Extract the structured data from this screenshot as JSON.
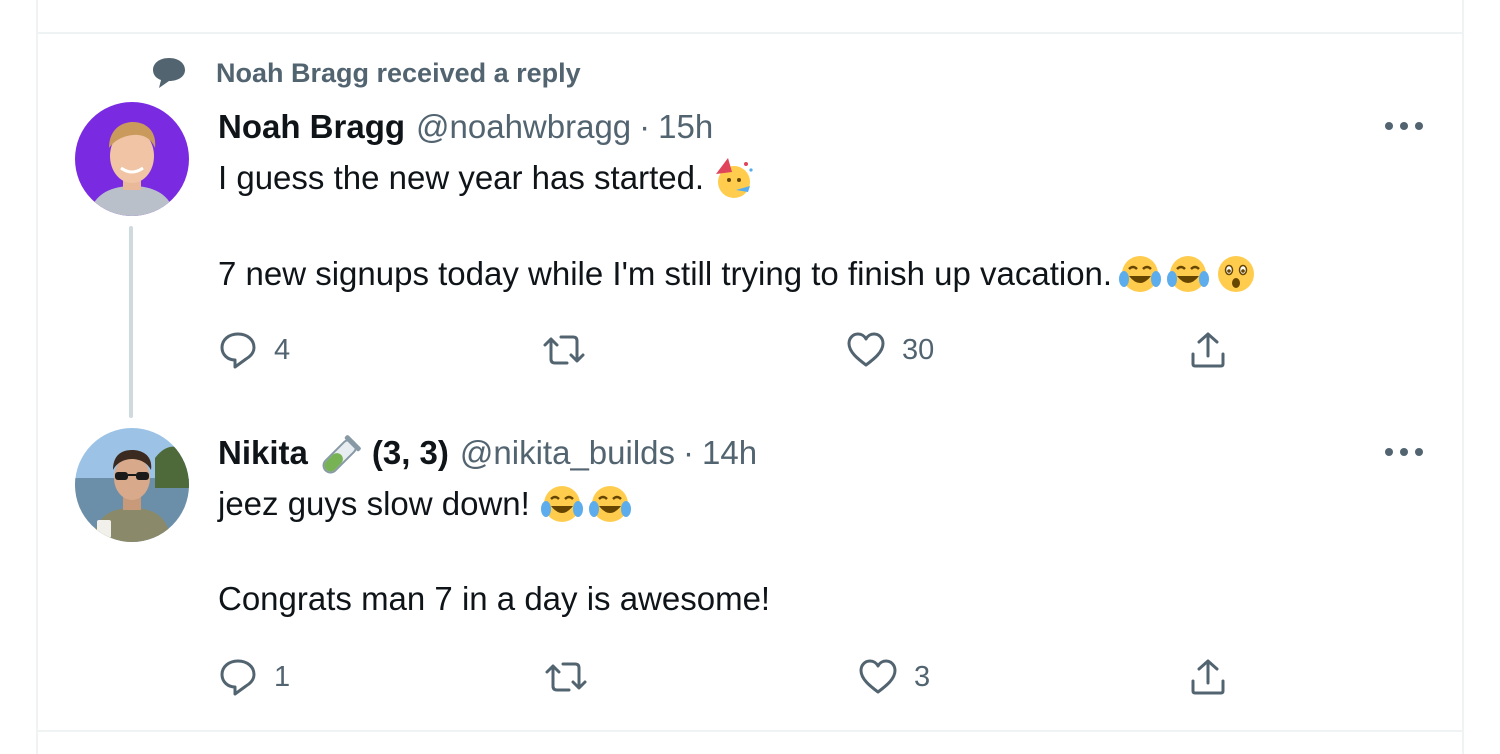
{
  "context": {
    "label": "Noah Bragg received a reply",
    "icon": "speech-bubble-icon"
  },
  "tweets": [
    {
      "name": "Noah Bragg",
      "handle": "@noahwbragg",
      "separator": "·",
      "time": "15h",
      "line1": "I guess the new year has started.",
      "line1_emojis": [
        "partying-face-emoji"
      ],
      "line2": "7 new signups today while I'm still trying to finish up vacation.",
      "line2_emojis": [
        "tears-of-joy-emoji",
        "tears-of-joy-emoji",
        "astonished-face-emoji"
      ],
      "avatar_bg": "#7a2be2",
      "actions": {
        "replies": "4",
        "retweets": "",
        "likes": "30"
      }
    },
    {
      "name": "Nikita",
      "badge": "(3, 3)",
      "handle": "@nikita_builds",
      "separator": "·",
      "time": "14h",
      "line1": "jeez guys slow down!",
      "line1_emojis": [
        "tears-of-joy-emoji",
        "tears-of-joy-emoji"
      ],
      "line2": "Congrats man 7 in a day is awesome!",
      "actions": {
        "replies": "1",
        "retweets": "",
        "likes": "3"
      }
    }
  ],
  "colors": {
    "secondary_text": "#536471",
    "primary_text": "#0f1419",
    "thread_line": "#cfd9de",
    "border": "#eff3f4"
  }
}
